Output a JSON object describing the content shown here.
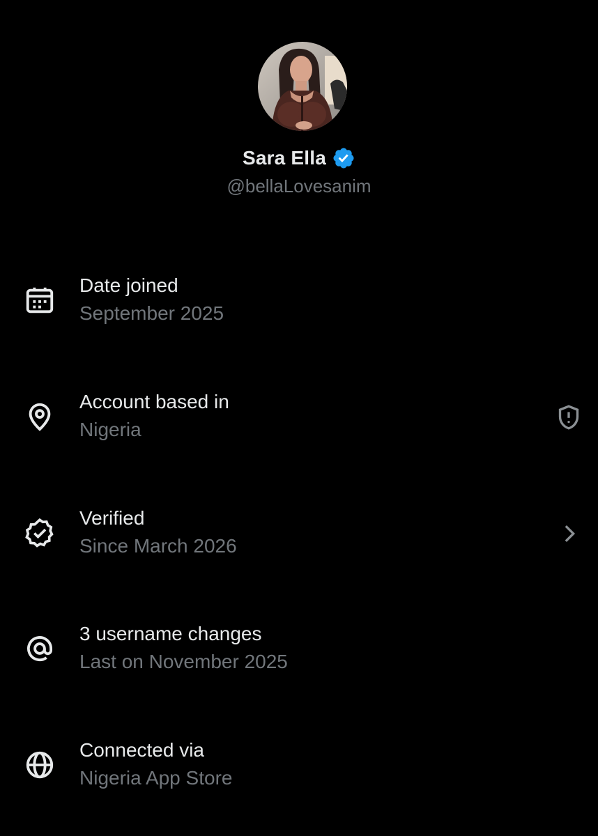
{
  "profile": {
    "name": "Sara Ella",
    "handle": "@bellaLovesanim",
    "verified_color": "#1d9bf0"
  },
  "rows": [
    {
      "icon": "calendar-icon",
      "title": "Date joined",
      "subtitle": "September 2025"
    },
    {
      "icon": "location-pin-icon",
      "title": "Account based in",
      "subtitle": "Nigeria",
      "right_icon": "shield-alert-icon"
    },
    {
      "icon": "verified-badge-icon",
      "title": "Verified",
      "subtitle": "Since March 2026",
      "right_icon": "chevron-right-icon"
    },
    {
      "icon": "at-sign-icon",
      "title": "3 username changes",
      "subtitle": "Last on November 2025"
    },
    {
      "icon": "globe-icon",
      "title": "Connected via",
      "subtitle": "Nigeria App Store"
    }
  ],
  "colors": {
    "background": "#000000",
    "primary_text": "#e7e9ea",
    "secondary_text": "#71767b"
  }
}
